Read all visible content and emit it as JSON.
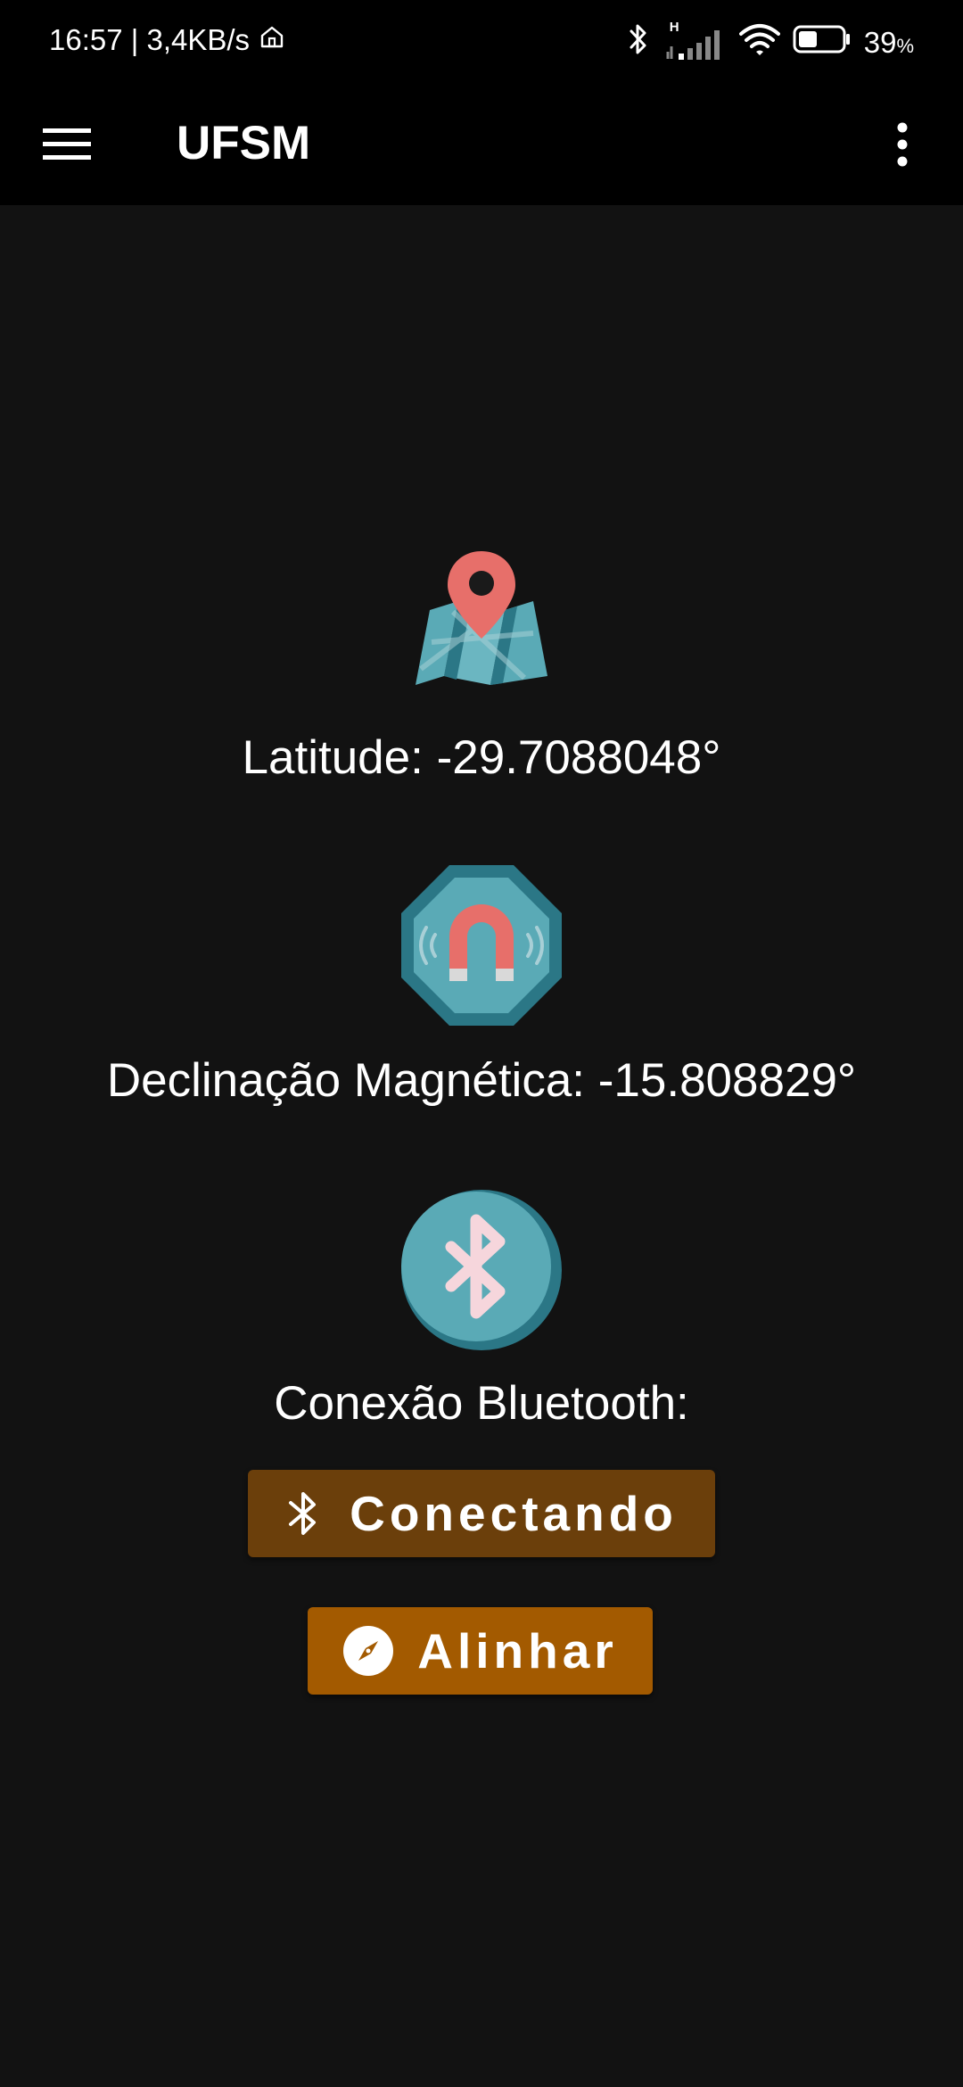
{
  "status_bar": {
    "time_speed": "16:57 | 3,4KB/s",
    "network_type": "H",
    "battery_percent": "39",
    "battery_unit": "%",
    "battery_level": 0.39,
    "icons": [
      "home-icon",
      "bluetooth-icon",
      "signal-icon",
      "wifi-icon",
      "battery-icon"
    ]
  },
  "app_bar": {
    "title": "UFSM",
    "menu_icon": "hamburger-menu-icon",
    "overflow_icon": "more-vert-icon"
  },
  "sections": {
    "latitude": {
      "icon": "map-pin-icon",
      "text": "Latitude: -29.7088048°"
    },
    "declination": {
      "icon": "magnet-icon",
      "text": "Declinação Magnética: -15.808829°"
    },
    "bluetooth": {
      "icon": "bluetooth-circle-icon",
      "text": "Conexão Bluetooth:"
    }
  },
  "buttons": {
    "connect": {
      "label": "Conectando",
      "icon": "bluetooth-icon",
      "color": "#6b3f0b"
    },
    "align": {
      "label": "Alinhar",
      "icon": "compass-icon",
      "color": "#a35a00"
    }
  },
  "colors": {
    "background": "#121212",
    "app_bar": "#000000",
    "pin_red": "#e76f6a",
    "teal": "#5aaab6",
    "teal_dark": "#2b7786"
  }
}
